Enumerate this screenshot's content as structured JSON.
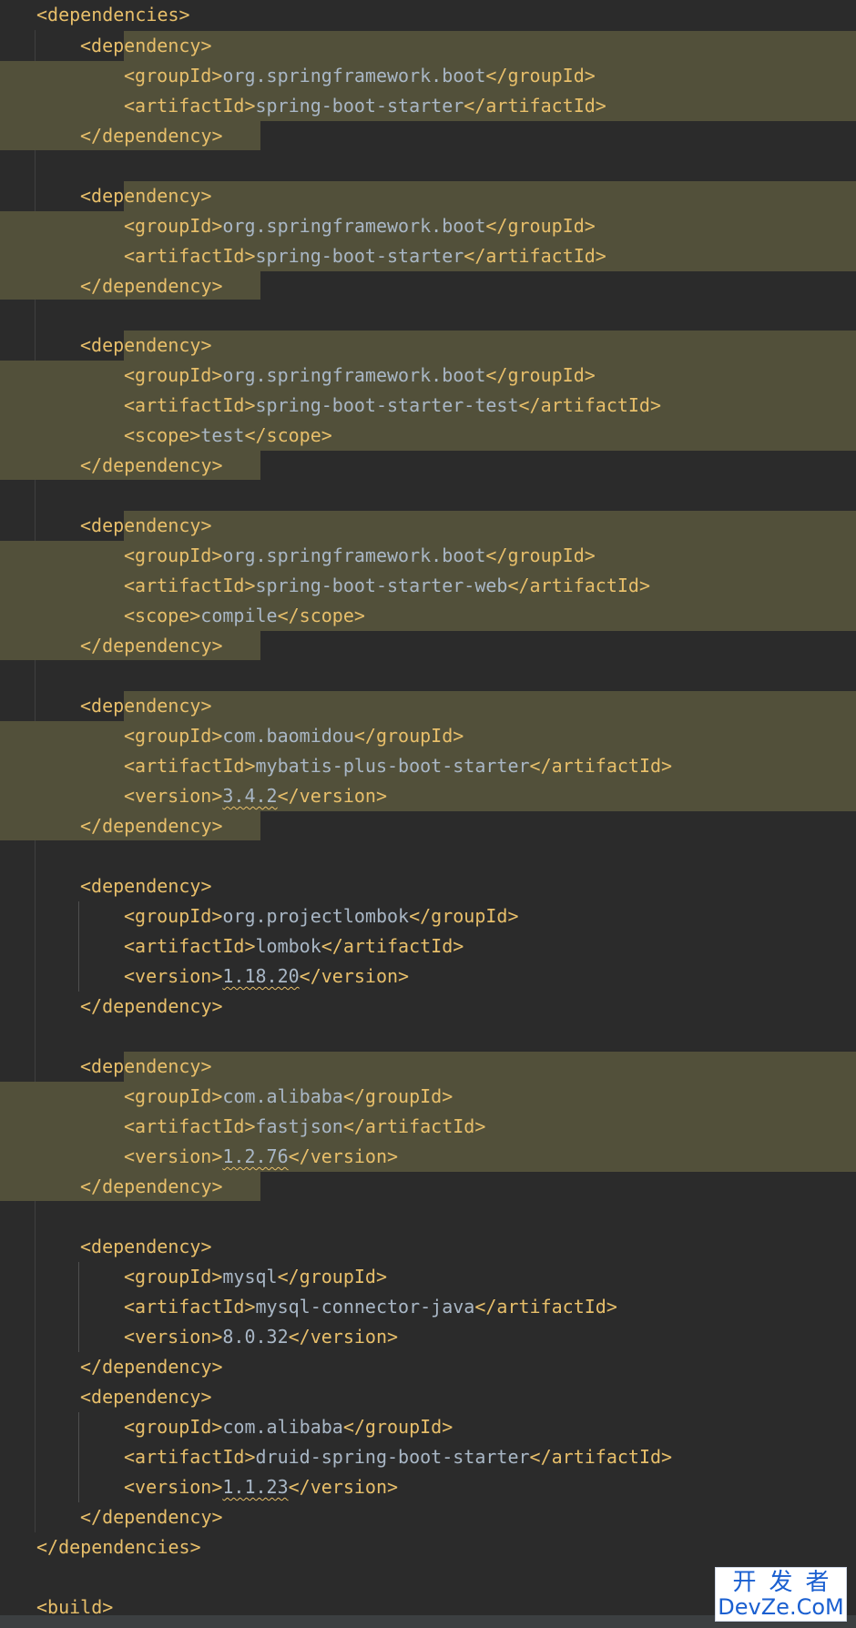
{
  "lines": [
    {
      "parts": [
        [
          "t",
          "<dependencies>"
        ]
      ]
    },
    {
      "parts": [
        [
          "t",
          "<dependency>"
        ]
      ]
    },
    {
      "parts": [
        [
          "t",
          "<groupId>"
        ],
        [
          "v",
          "org.springframework.boot"
        ],
        [
          "t",
          "</groupId>"
        ]
      ]
    },
    {
      "parts": [
        [
          "t",
          "<artifactId>"
        ],
        [
          "v",
          "spring-boot-starter"
        ],
        [
          "t",
          "</artifactId>"
        ]
      ]
    },
    {
      "parts": [
        [
          "t",
          "</dependency>"
        ]
      ]
    },
    {
      "parts": []
    },
    {
      "parts": [
        [
          "t",
          "<dependency>"
        ]
      ]
    },
    {
      "parts": [
        [
          "t",
          "<groupId>"
        ],
        [
          "v",
          "org.springframework.boot"
        ],
        [
          "t",
          "</groupId>"
        ]
      ]
    },
    {
      "parts": [
        [
          "t",
          "<artifactId>"
        ],
        [
          "v",
          "spring-boot-starter"
        ],
        [
          "t",
          "</artifactId>"
        ]
      ]
    },
    {
      "parts": [
        [
          "t",
          "</dependency>"
        ]
      ]
    },
    {
      "parts": []
    },
    {
      "parts": [
        [
          "t",
          "<dependency>"
        ]
      ]
    },
    {
      "parts": [
        [
          "t",
          "<groupId>"
        ],
        [
          "v",
          "org.springframework.boot"
        ],
        [
          "t",
          "</groupId>"
        ]
      ]
    },
    {
      "parts": [
        [
          "t",
          "<artifactId>"
        ],
        [
          "v",
          "spring-boot-starter-test"
        ],
        [
          "t",
          "</artifactId>"
        ]
      ]
    },
    {
      "parts": [
        [
          "t",
          "<scope>"
        ],
        [
          "v",
          "test"
        ],
        [
          "t",
          "</scope>"
        ]
      ]
    },
    {
      "parts": [
        [
          "t",
          "</dependency>"
        ]
      ]
    },
    {
      "parts": []
    },
    {
      "parts": [
        [
          "t",
          "<dependency>"
        ]
      ]
    },
    {
      "parts": [
        [
          "t",
          "<groupId>"
        ],
        [
          "v",
          "org.springframework.boot"
        ],
        [
          "t",
          "</groupId>"
        ]
      ]
    },
    {
      "parts": [
        [
          "t",
          "<artifactId>"
        ],
        [
          "v",
          "spring-boot-starter-web"
        ],
        [
          "t",
          "</artifactId>"
        ]
      ]
    },
    {
      "parts": [
        [
          "t",
          "<scope>"
        ],
        [
          "v",
          "compile"
        ],
        [
          "t",
          "</scope>"
        ]
      ]
    },
    {
      "parts": [
        [
          "t",
          "</dependency>"
        ]
      ]
    },
    {
      "parts": []
    },
    {
      "parts": [
        [
          "t",
          "<dependency>"
        ]
      ]
    },
    {
      "parts": [
        [
          "t",
          "<groupId>"
        ],
        [
          "v",
          "com.baomidou"
        ],
        [
          "t",
          "</groupId>"
        ]
      ]
    },
    {
      "parts": [
        [
          "t",
          "<artifactId>"
        ],
        [
          "v",
          "mybatis-plus-boot-starter"
        ],
        [
          "t",
          "</artifactId>"
        ]
      ]
    },
    {
      "parts": [
        [
          "t",
          "<version>"
        ],
        [
          "w",
          "3.4.2"
        ],
        [
          "t",
          "</version>"
        ]
      ]
    },
    {
      "parts": [
        [
          "t",
          "</dependency>"
        ]
      ]
    },
    {
      "parts": []
    },
    {
      "parts": [
        [
          "t",
          "<dependency>"
        ]
      ]
    },
    {
      "parts": [
        [
          "t",
          "<groupId>"
        ],
        [
          "v",
          "org.projectlombok"
        ],
        [
          "t",
          "</groupId>"
        ]
      ]
    },
    {
      "parts": [
        [
          "t",
          "<artifactId>"
        ],
        [
          "v",
          "lombok"
        ],
        [
          "t",
          "</artifactId>"
        ]
      ]
    },
    {
      "parts": [
        [
          "t",
          "<version>"
        ],
        [
          "w",
          "1.18.20"
        ],
        [
          "t",
          "</version>"
        ]
      ]
    },
    {
      "parts": [
        [
          "t",
          "</dependency>"
        ]
      ]
    },
    {
      "parts": []
    },
    {
      "parts": [
        [
          "t",
          "<dependency>"
        ]
      ]
    },
    {
      "parts": [
        [
          "t",
          "<groupId>"
        ],
        [
          "v",
          "com.alibaba"
        ],
        [
          "t",
          "</groupId>"
        ]
      ]
    },
    {
      "parts": [
        [
          "t",
          "<artifactId>"
        ],
        [
          "v",
          "fastjson"
        ],
        [
          "t",
          "</artifactId>"
        ]
      ]
    },
    {
      "parts": [
        [
          "t",
          "<version>"
        ],
        [
          "w",
          "1.2.76"
        ],
        [
          "t",
          "</version>"
        ]
      ]
    },
    {
      "parts": [
        [
          "t",
          "</dependency>"
        ]
      ]
    },
    {
      "parts": []
    },
    {
      "parts": [
        [
          "t",
          "<dependency>"
        ]
      ]
    },
    {
      "parts": [
        [
          "t",
          "<groupId>"
        ],
        [
          "v",
          "mysql"
        ],
        [
          "t",
          "</groupId>"
        ]
      ]
    },
    {
      "parts": [
        [
          "t",
          "<artifactId>"
        ],
        [
          "v",
          "mysql-connector-java"
        ],
        [
          "t",
          "</artifactId>"
        ]
      ]
    },
    {
      "parts": [
        [
          "t",
          "<version>"
        ],
        [
          "v",
          "8.0.32"
        ],
        [
          "t",
          "</version>"
        ]
      ]
    },
    {
      "parts": [
        [
          "t",
          "</dependency>"
        ]
      ]
    },
    {
      "parts": [
        [
          "t",
          "<dependency>"
        ]
      ]
    },
    {
      "parts": [
        [
          "t",
          "<groupId>"
        ],
        [
          "v",
          "com.alibaba"
        ],
        [
          "t",
          "</groupId>"
        ]
      ]
    },
    {
      "parts": [
        [
          "t",
          "<artifactId>"
        ],
        [
          "v",
          "druid-spring-boot-starter"
        ],
        [
          "t",
          "</artifactId>"
        ]
      ]
    },
    {
      "parts": [
        [
          "t",
          "<version>"
        ],
        [
          "w",
          "1.1.23"
        ],
        [
          "t",
          "</version>"
        ]
      ]
    },
    {
      "parts": [
        [
          "t",
          "</dependency>"
        ]
      ]
    },
    {
      "parts": [
        [
          "t",
          "</dependencies>"
        ]
      ]
    },
    {
      "parts": []
    },
    {
      "parts": [
        [
          "t",
          "<build>"
        ]
      ]
    }
  ],
  "watermark": {
    "top": "开发者",
    "bottom": "DevZe.CoM"
  },
  "colors": {
    "background": "#2b2b2b",
    "tag": "#e8bf6a",
    "text": "#a9b7c6",
    "highlight": "#52503a"
  }
}
